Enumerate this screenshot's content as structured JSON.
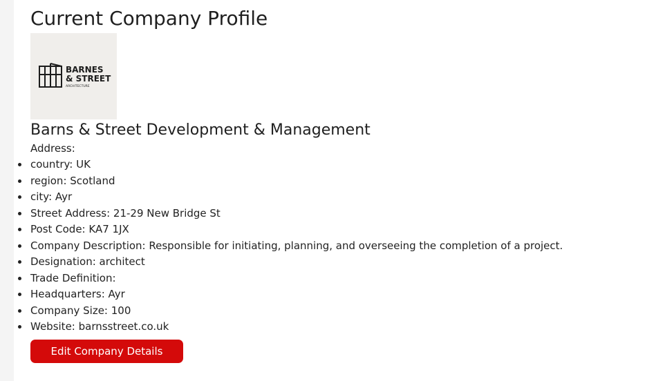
{
  "page": {
    "title": "Current Company Profile"
  },
  "logo": {
    "line1": "BARNES",
    "line2": "& STREET",
    "line3": "ARCHITECTURE"
  },
  "company": {
    "name": "Barns & Street Development & Management",
    "address_label": "Address:",
    "details": [
      "country: UK",
      "region: Scotland",
      "city: Ayr",
      "Street Address: 21-29 New Bridge St",
      "Post Code: KA7 1JX",
      "Company Description: Responsible for initiating, planning, and overseeing the completion of a project.",
      "Designation: architect",
      "Trade Definition:",
      "Headquarters: Ayr",
      "Company Size: 100",
      "Website: barnsstreet.co.uk"
    ]
  },
  "actions": {
    "edit_label": "Edit Company Details"
  },
  "colors": {
    "button_bg": "#d40a0a",
    "logo_bg": "#f0eeeb"
  }
}
